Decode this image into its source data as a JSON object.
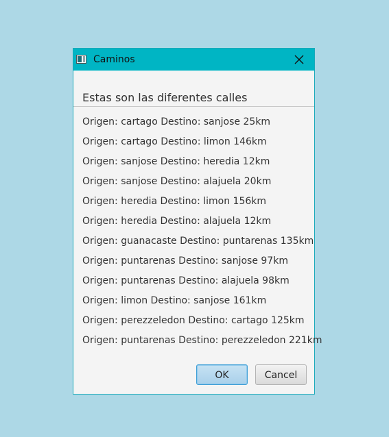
{
  "window": {
    "title": "Caminos"
  },
  "header": {
    "text": "Estas son las diferentes calles"
  },
  "routes": [
    "Origen: cartago Destino: sanjose 25km",
    "Origen: cartago Destino: limon 146km",
    "Origen: sanjose Destino: heredia 12km",
    "Origen: sanjose Destino: alajuela 20km",
    "Origen: heredia Destino: limon 156km",
    "Origen: heredia Destino: alajuela 12km",
    "Origen: guanacaste Destino: puntarenas 135km",
    "Origen: puntarenas Destino: sanjose 97km",
    "Origen: puntarenas Destino: alajuela 98km",
    "Origen: limon Destino: sanjose 161km",
    "Origen: perezzeledon Destino: cartago 125km",
    "Origen: puntarenas Destino: perezzeledon 221km"
  ],
  "buttons": {
    "ok_label": "OK",
    "cancel_label": "Cancel"
  },
  "colors": {
    "background": "#add8e6",
    "titlebar": "#00b5c4",
    "dialog": "#f4f4f4"
  },
  "icons": {
    "app": "window-app-icon",
    "close": "close-icon"
  }
}
